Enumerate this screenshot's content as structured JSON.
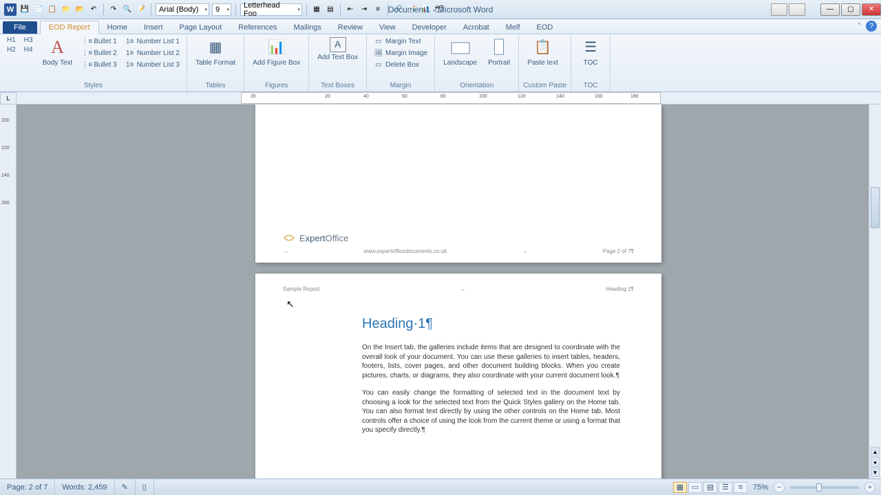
{
  "app": {
    "title": "Document1 - Microsoft Word"
  },
  "qat": {
    "font_name": "Arial (Body)",
    "font_size": "9",
    "page_size": "Letterhead Foo"
  },
  "tabs": {
    "file": "File",
    "items": [
      "EOD Report",
      "Home",
      "Insert",
      "Page Layout",
      "References",
      "Mailings",
      "Review",
      "View",
      "Developer",
      "Acrobat",
      "Melf",
      "EOD"
    ],
    "active_index": 0
  },
  "ribbon": {
    "styles": {
      "label": "Styles",
      "h1": "H1",
      "h2": "H2",
      "h3": "H3",
      "h4": "H4",
      "body_text": "Body Text",
      "bullet1": "Bullet 1",
      "bullet2": "Bullet 2",
      "bullet3": "Bullet 3",
      "num1": "Number List 1",
      "num2": "Number List 2",
      "num3": "Number List 3"
    },
    "tables": {
      "label": "Tables",
      "btn": "Table Format"
    },
    "figures": {
      "label": "Figures",
      "btn": "Add Figure Box"
    },
    "textboxes": {
      "label": "Text Boxes",
      "btn": "Add Text Box"
    },
    "margin": {
      "label": "Margin",
      "mt": "Margin Text",
      "mi": "Margin Image",
      "db": "Delete Box"
    },
    "orientation": {
      "label": "Orientation",
      "landscape": "Landscape",
      "portrait": "Portrait"
    },
    "custompaste": {
      "label": "Custom Paste",
      "btn": "Paste text"
    },
    "toc": {
      "label": "TOC",
      "btn": "TOC"
    }
  },
  "ruler": {
    "h_ticks": [
      "20",
      "",
      "20",
      "40",
      "60",
      "80",
      "100",
      "120",
      "140",
      "160",
      "180"
    ],
    "v_ticks": [
      "200",
      "220",
      "240",
      "260"
    ]
  },
  "doc": {
    "logo_text_a": "E",
    "logo_text_b": "xpert",
    "logo_text_c": "Office",
    "footer_url": "www.expertofficedocuments.co.uk",
    "footer_page": "Page 2 of 7¶",
    "header_left": "Sample Report",
    "header_right": "Heading 1¶",
    "heading": "Heading·1¶",
    "para1": "On the Insert tab, the galleries include items that are designed to coordinate with the overall look of your document. You can use these galleries to insert tables, headers, footers, lists, cover pages, and other document building blocks. When you create pictures, charts, or diagrams, they also coordinate with your current document look.¶",
    "para2": "You can easily change the formatting of selected text in the document text by choosing a look for the selected text from the Quick Styles gallery on the Home tab. You can also format text directly by using the other controls on the Home tab. Most controls offer a choice of using the look from the current theme or using a format that you specify directly.¶"
  },
  "status": {
    "page": "Page: 2 of 7",
    "words": "Words: 2,459",
    "zoom": "75%"
  }
}
